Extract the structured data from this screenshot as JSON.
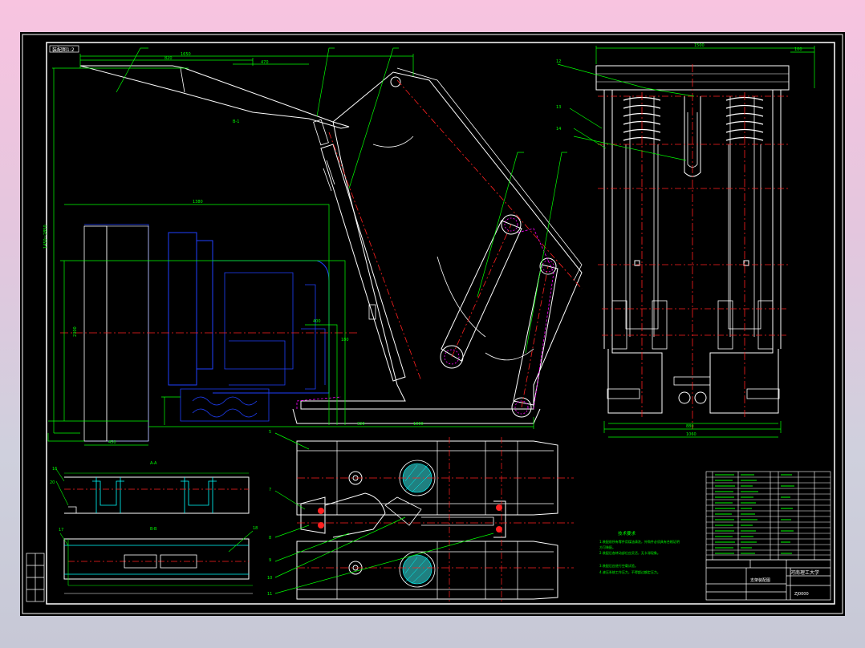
{
  "drawing": {
    "corner_label": "装配图1:2",
    "section_labels": [
      "A-A",
      "B-B"
    ],
    "tech_req": {
      "heading": "技术要求",
      "lines": [
        "1.装配前所有零件用煤油清洗，外购件必须具有合格证明",
        "方可装配。",
        "2.装配后各转动部位应灵活，无卡滞现象。",
        "3.装配后应进行空载试验。",
        "4.液压系统工作压力，不得超过额定压力。"
      ]
    },
    "title_block": {
      "school": "河南理工大学",
      "title": "支架装配图",
      "code": "ZJ0000"
    },
    "colors": {
      "background": "#000000",
      "frame": "#ffffff",
      "dimension": "#00ff00",
      "centerline": "#ff2020",
      "hidden": "#2040ff",
      "phantom": "#ff00ff"
    }
  }
}
